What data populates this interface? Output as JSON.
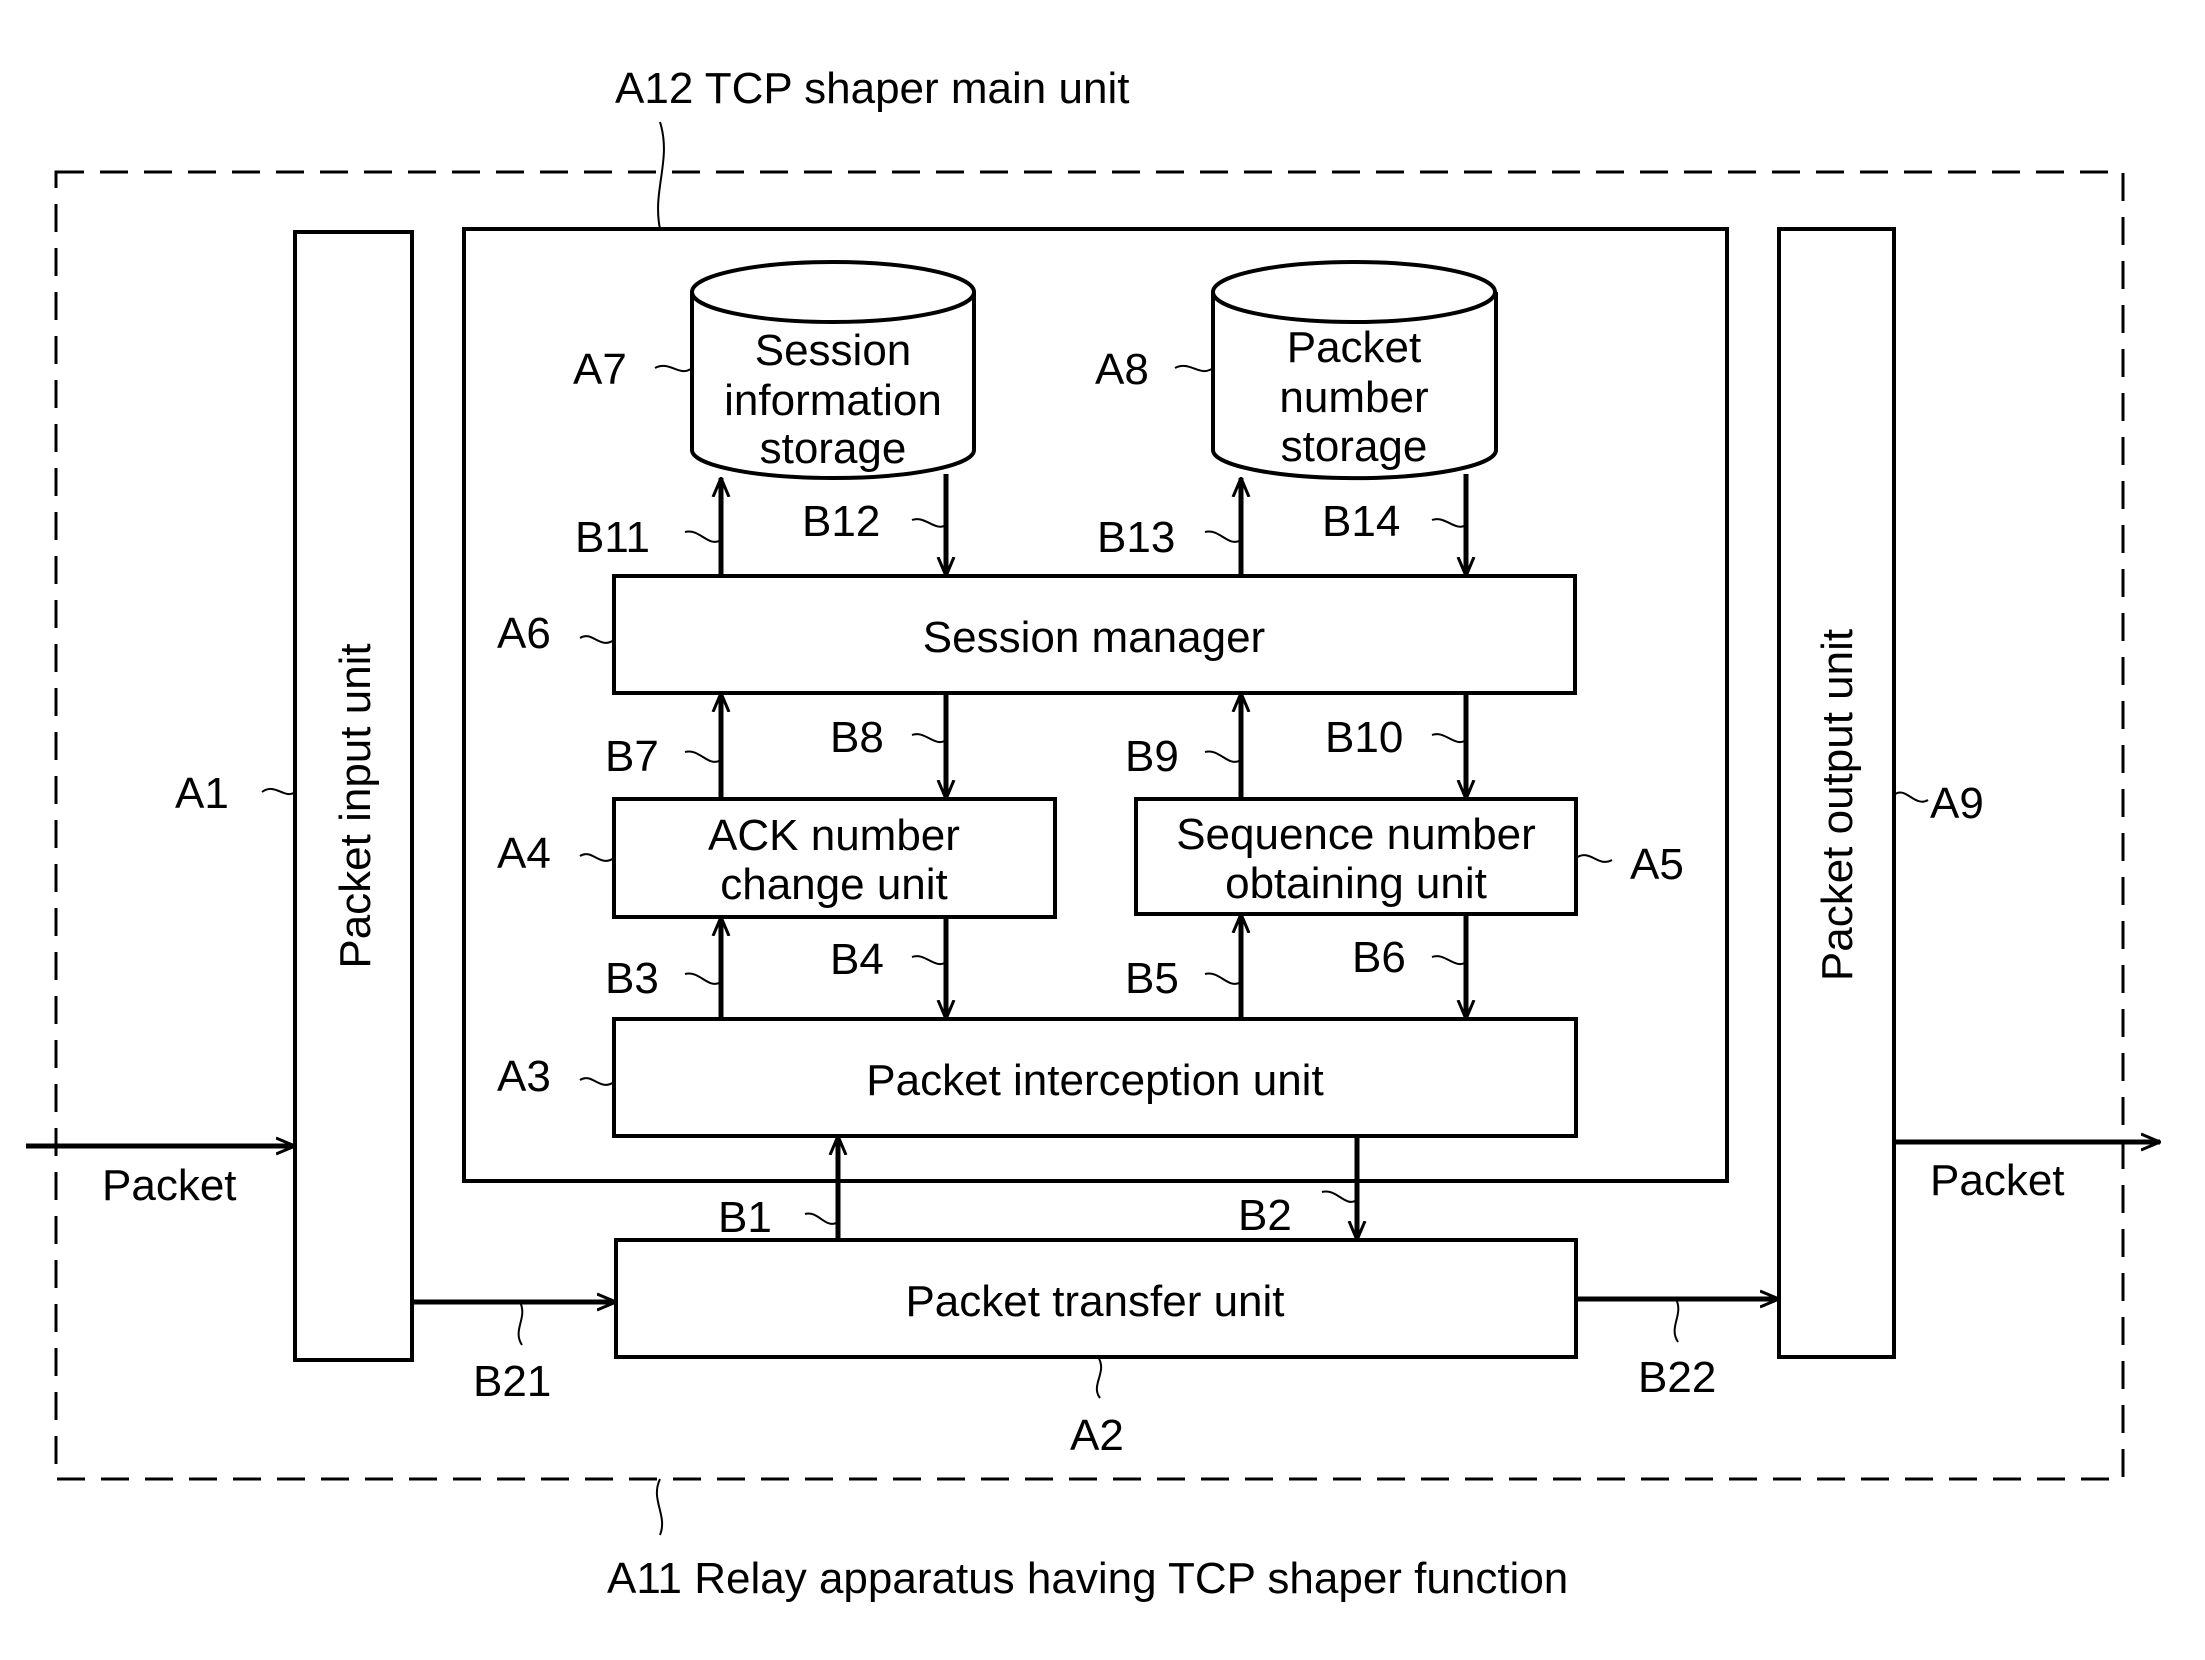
{
  "title_top": "A12 TCP shaper main unit",
  "title_bottom": "A11 Relay apparatus having TCP shaper function",
  "blocks": {
    "packet_input": {
      "ref": "A1",
      "label": "Packet input unit"
    },
    "packet_transfer": {
      "ref": "A2",
      "label": "Packet transfer unit"
    },
    "packet_interception": {
      "ref": "A3",
      "label": "Packet interception unit"
    },
    "ack_change": {
      "ref": "A4",
      "line1": "ACK number",
      "line2": "change unit"
    },
    "seq_obtain": {
      "ref": "A5",
      "line1": "Sequence number",
      "line2": "obtaining unit"
    },
    "session_manager": {
      "ref": "A6",
      "label": "Session manager"
    },
    "session_storage": {
      "ref": "A7",
      "line1": "Session",
      "line2": "information",
      "line3": "storage"
    },
    "packet_number_storage": {
      "ref": "A8",
      "line1": "Packet",
      "line2": "number",
      "line3": "storage"
    },
    "packet_output": {
      "ref": "A9",
      "label": "Packet output unit"
    }
  },
  "io": {
    "input_label": "Packet",
    "output_label": "Packet"
  },
  "arrows": {
    "b1": "B1",
    "b2": "B2",
    "b3": "B3",
    "b4": "B4",
    "b5": "B5",
    "b6": "B6",
    "b7": "B7",
    "b8": "B8",
    "b9": "B9",
    "b10": "B10",
    "b11": "B11",
    "b12": "B12",
    "b13": "B13",
    "b14": "B14",
    "b21": "B21",
    "b22": "B22"
  }
}
